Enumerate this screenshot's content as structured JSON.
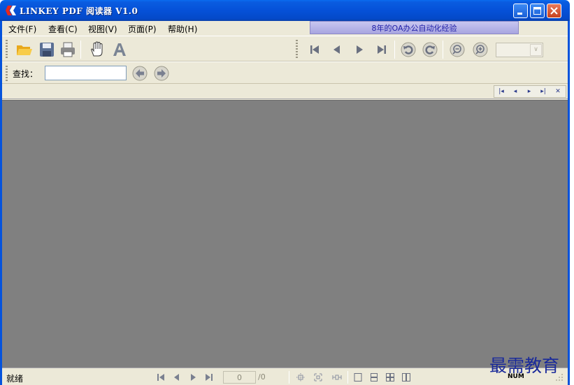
{
  "window": {
    "title": "LINKEY PDF 阅读器 V1.0",
    "colors": {
      "titlebar": "#0551d8",
      "chrome": "#ece9d8",
      "document_area": "#808080"
    }
  },
  "menu": {
    "items": [
      {
        "label": "文件(F)"
      },
      {
        "label": "查看(C)"
      },
      {
        "label": "视图(V)"
      },
      {
        "label": "页面(P)"
      },
      {
        "label": "帮助(H)"
      }
    ],
    "banner": "8年的OA办公自动化经验"
  },
  "toolbar": {
    "left_icons": [
      "open-folder-icon",
      "save-icon",
      "print-icon",
      "hand-tool-icon",
      "text-select-icon"
    ],
    "right_icons": [
      "first-page-icon",
      "prev-page-icon",
      "next-page-icon",
      "last-page-icon",
      "rotate-left-icon",
      "rotate-right-icon",
      "zoom-out-icon",
      "zoom-in-icon"
    ],
    "zoom_value": ""
  },
  "find": {
    "label": "查找：",
    "value": "",
    "prev_icon": "find-prev-icon",
    "next_icon": "find-next-icon"
  },
  "tab_nav": {
    "buttons": [
      "|◂",
      "◂",
      "▸",
      "▸|",
      "✕"
    ]
  },
  "status": {
    "text": "就绪",
    "page_input": "0",
    "page_total": "/0",
    "num_lock": "NUM"
  },
  "watermark": "最需教育"
}
